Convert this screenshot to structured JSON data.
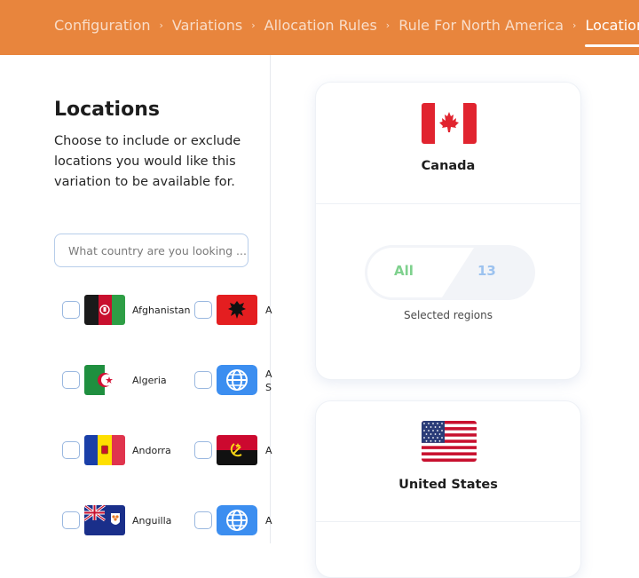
{
  "breadcrumb": {
    "items": [
      "Configuration",
      "Variations",
      "Allocation Rules",
      "Rule For North America",
      "Locations"
    ],
    "separator": "›",
    "active_index": 4
  },
  "panel": {
    "title": "Locations",
    "description": "Choose to include or exclude locations you would like this variation to be available for.",
    "search_placeholder": "What country are you looking ..."
  },
  "countries": [
    {
      "name": "Afghanistan",
      "flag": "afghanistan-flag-icon"
    },
    {
      "name": "A",
      "flag": "albania-flag-icon"
    },
    {
      "name": "Algeria",
      "flag": "algeria-flag-icon"
    },
    {
      "name": "A",
      "name2": "S",
      "flag": "globe-icon"
    },
    {
      "name": "Andorra",
      "flag": "andorra-flag-icon"
    },
    {
      "name": "A",
      "flag": "angola-flag-icon"
    },
    {
      "name": "Anguilla",
      "flag": "anguilla-flag-icon"
    },
    {
      "name": "A",
      "flag": "globe-icon"
    }
  ],
  "cards": [
    {
      "title": "Canada",
      "toggle_all": "All",
      "toggle_count": "13",
      "selected_label": "Selected regions"
    },
    {
      "title": "United States"
    }
  ],
  "colors": {
    "header": "#E8853D",
    "toggle_all": "#7fd18e",
    "toggle_count": "#9cc2ef",
    "checkbox_border": "#9ab8e0"
  }
}
